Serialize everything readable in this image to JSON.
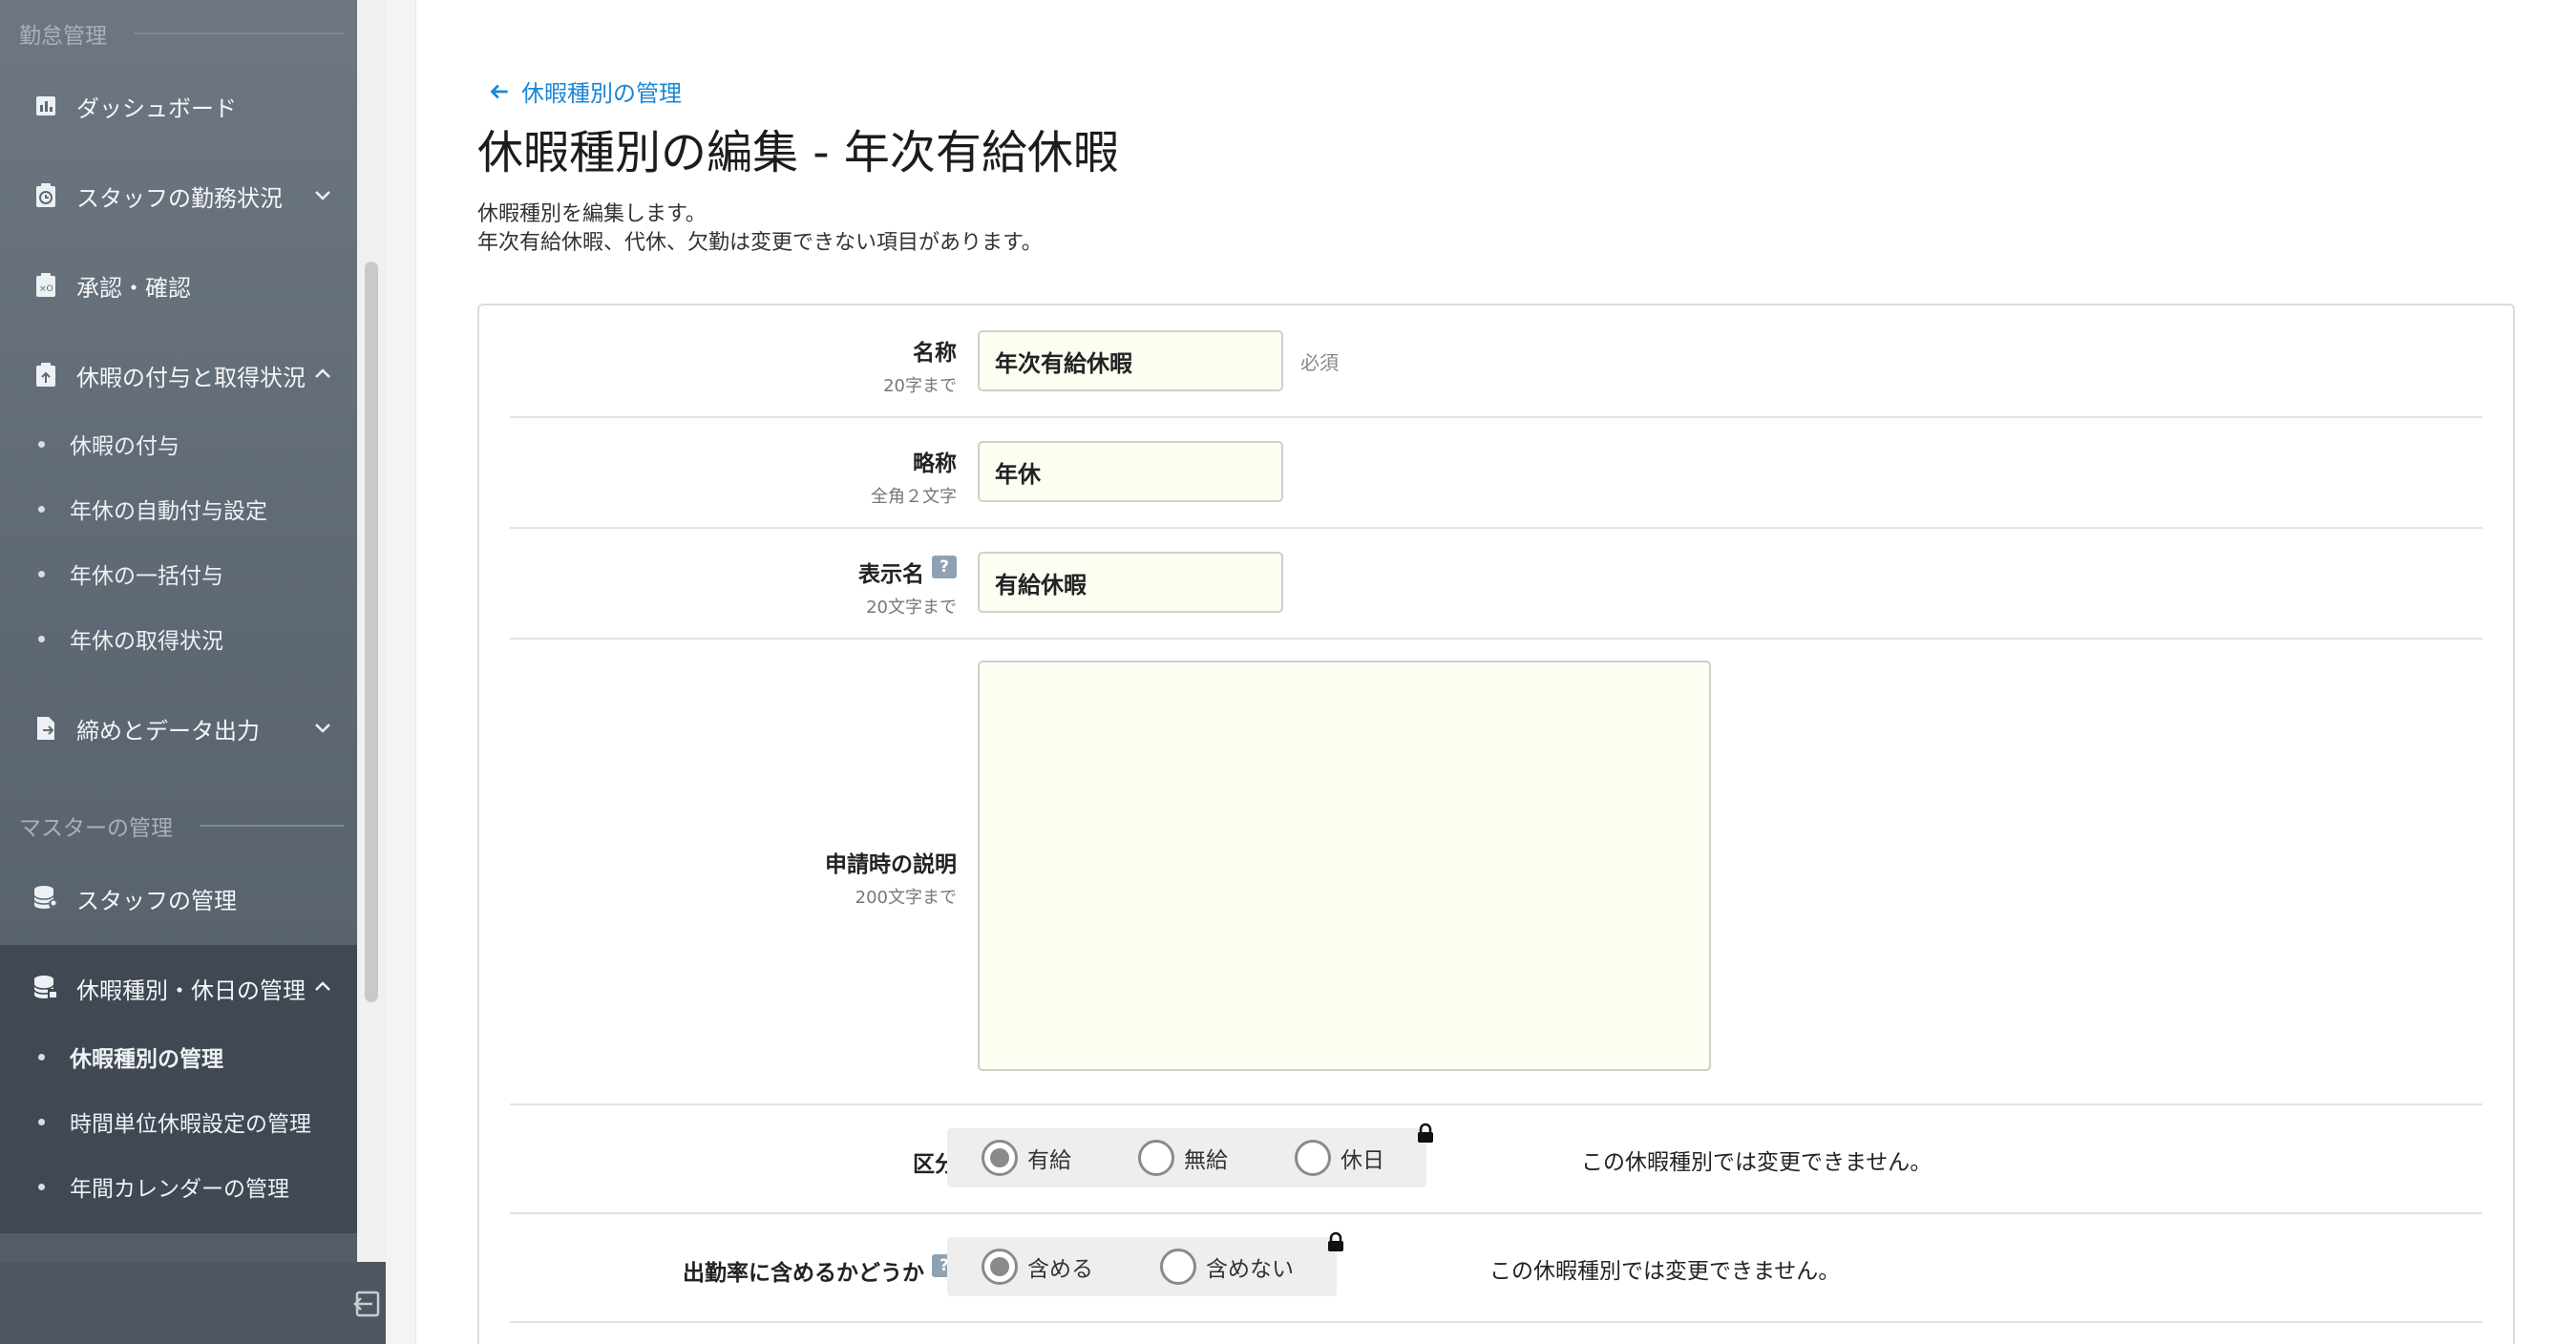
{
  "sidebar": {
    "section_attendance": "勤怠管理",
    "section_master": "マスターの管理",
    "items": {
      "dashboard": "ダッシュボード",
      "staff_status": "スタッフの勤務状況",
      "approval": "承認・確認",
      "leave_grant_status": "休暇の付与と取得状況",
      "leave_grant": "休暇の付与",
      "annual_auto_grant": "年休の自動付与設定",
      "annual_bulk_grant": "年休の一括付与",
      "annual_usage": "年休の取得状況",
      "closing_export": "締めとデータ出力",
      "staff_management": "スタッフの管理",
      "leave_holiday_management": "休暇種別・休日の管理",
      "leave_type_management": "休暇種別の管理",
      "hourly_leave_management": "時間単位休暇設定の管理",
      "annual_calendar": "年間カレンダーの管理"
    }
  },
  "main": {
    "back_link": "休暇種別の管理",
    "title": "休暇種別の編集 - 年次有給休暇",
    "desc_line1": "休暇種別を編集します。",
    "desc_line2": "年次有給休暇、代休、欠勤は変更できない項目があります。"
  },
  "form": {
    "name": {
      "label": "名称",
      "hint": "20字まで",
      "value": "年次有給休暇",
      "required": "必須"
    },
    "short_name": {
      "label": "略称",
      "hint": "全角２文字",
      "value": "年休"
    },
    "display_name": {
      "label": "表示名",
      "hint": "20文字まで",
      "value": "有給休暇",
      "help": "?"
    },
    "description": {
      "label": "申請時の説明",
      "hint": "200文字まで",
      "value": ""
    },
    "category": {
      "label": "区分",
      "options": [
        "有給",
        "無給",
        "休日"
      ],
      "selected": "有給",
      "note": "この休暇種別では変更できません。"
    },
    "attendance_rate": {
      "label": "出勤率に含めるかどうか",
      "help": "?",
      "options": [
        "含める",
        "含めない"
      ],
      "selected": "含める",
      "note": "この休暇種別では変更できません。"
    }
  }
}
